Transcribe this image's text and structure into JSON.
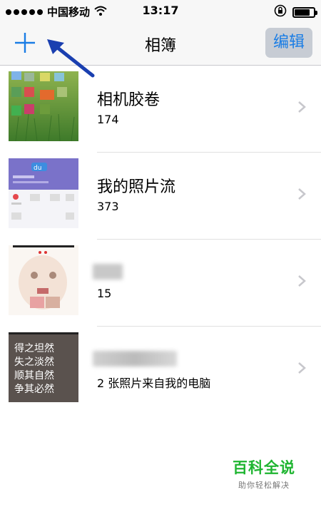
{
  "status_bar": {
    "carrier": "中国移动",
    "time": "13:17",
    "battery_level": 0.8
  },
  "nav": {
    "title": "相簿",
    "add_icon": "plus-icon",
    "edit_label": "编辑"
  },
  "albums": [
    {
      "name": "相机胶卷",
      "count": "174"
    },
    {
      "name": "我的照片流",
      "count": "373"
    },
    {
      "name": "",
      "count": "15"
    },
    {
      "name": "",
      "count": "2 张照片来自我的电脑"
    }
  ],
  "thumbnail_text": {
    "album4": [
      "得之坦然",
      "失之淡然",
      "顺其自然",
      "争其必然"
    ]
  },
  "watermark": {
    "main": "百科全说",
    "sub": "助你轻松解决"
  },
  "colors": {
    "accent": "#1a7de5",
    "annotation_arrow": "#1a3fb0",
    "watermark": "#1fb531"
  }
}
